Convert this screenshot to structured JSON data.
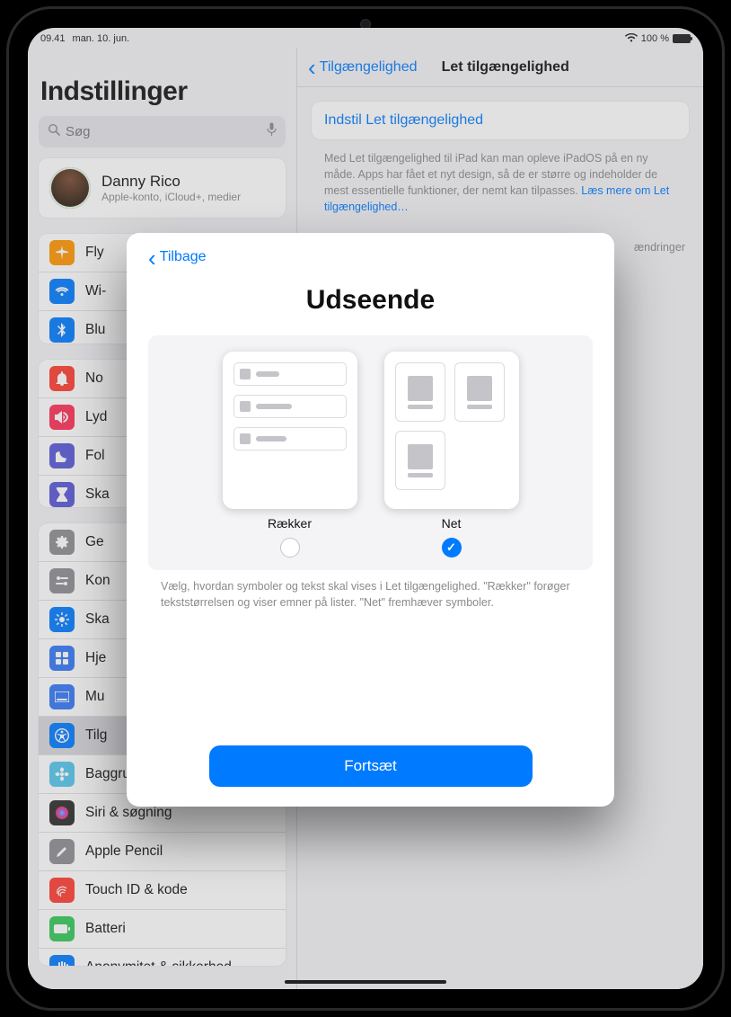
{
  "status": {
    "time": "09.41",
    "date_text": "man. 10. jun.",
    "battery_text": "100 %"
  },
  "sidebar": {
    "title": "Indstillinger",
    "search_placeholder": "Søg",
    "account": {
      "name": "Danny Rico",
      "sub": "Apple-konto, iCloud+, medier"
    },
    "group1": [
      {
        "label": "Fly",
        "color": "#ff9500",
        "icon": "airplane"
      },
      {
        "label": "Wi-",
        "color": "#007aff",
        "icon": "wifi"
      },
      {
        "label": "Blu",
        "color": "#007aff",
        "icon": "bluetooth"
      }
    ],
    "group2": [
      {
        "label": "No",
        "color": "#ff3b30",
        "icon": "bell"
      },
      {
        "label": "Lyd",
        "color": "#ff2d55",
        "icon": "speaker"
      },
      {
        "label": "Fol",
        "color": "#5856d6",
        "icon": "moon"
      },
      {
        "label": "Ska",
        "color": "#5856d6",
        "icon": "hourglass"
      }
    ],
    "group3": [
      {
        "label": "Ge",
        "color": "#8e8e93",
        "icon": "gear"
      },
      {
        "label": "Kon",
        "color": "#8e8e93",
        "icon": "switches"
      },
      {
        "label": "Ska",
        "color": "#007aff",
        "icon": "brightness"
      },
      {
        "label": "Hje",
        "color": "#3378f6",
        "icon": "grid"
      },
      {
        "label": "Mu",
        "color": "#3378f6",
        "icon": "dock"
      },
      {
        "label": "Tilg",
        "color": "#007aff",
        "icon": "accessibility",
        "active": true
      },
      {
        "label": "Baggrund",
        "color": "#54c7ec",
        "icon": "flower"
      },
      {
        "label": "Siri & søgning",
        "color": "#2b2b2c",
        "icon": "siri"
      },
      {
        "label": "Apple Pencil",
        "color": "#8e8e93",
        "icon": "pencil"
      },
      {
        "label": "Touch ID & kode",
        "color": "#ff3b30",
        "icon": "touchid"
      },
      {
        "label": "Batteri",
        "color": "#34c759",
        "icon": "battery"
      },
      {
        "label": "Anonymitet & sikkerhed",
        "color": "#007aff",
        "icon": "hand"
      }
    ]
  },
  "detail": {
    "back_label": "Tilgængelighed",
    "title": "Let tilgængelighed",
    "setup_label": "Indstil Let tilgængelighed",
    "description_prefix": "Med Let tilgængelighed til iPad kan man opleve iPadOS på en ny måde. Apps har fået et nyt design, så de er større og indeholder de mest essentielle funktioner, der nemt kan tilpasses. ",
    "description_link": "Læs mere om Let tilgængelighed…",
    "changes_note": "ændringer"
  },
  "sheet": {
    "back_label": "Tilbage",
    "title": "Udseende",
    "option_rows": "Rækker",
    "option_grid": "Net",
    "selected": "grid",
    "footnote": "Vælg, hvordan symboler og tekst skal vises i Let tilgængelighed. \"Rækker\" forøger tekststørrelsen og viser emner på lister. \"Net\" fremhæver symboler.",
    "continue": "Fortsæt"
  }
}
